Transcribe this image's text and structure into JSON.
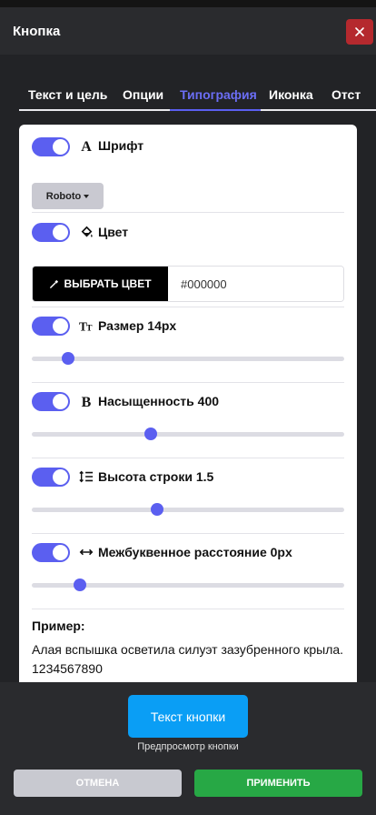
{
  "modal": {
    "title": "Кнопка",
    "close_icon": "close-icon"
  },
  "tabs": [
    {
      "label": "Текст и цель",
      "active": false
    },
    {
      "label": "Опции",
      "active": false
    },
    {
      "label": "Типография",
      "active": true
    },
    {
      "label": "Иконка",
      "active": false
    },
    {
      "label": "Отст",
      "active": false
    }
  ],
  "typography": {
    "font": {
      "enabled": true,
      "label": "Шрифт",
      "icon": "font-icon",
      "value": "Roboto"
    },
    "color": {
      "enabled": true,
      "label": "Цвет",
      "icon": "paint-bucket-icon",
      "pick_label": "ВЫБРАТЬ ЦВЕТ",
      "pick_icon": "eyedropper-icon",
      "value": "#000000"
    },
    "size": {
      "enabled": true,
      "label": "Размер 14px",
      "icon": "text-size-icon",
      "value": 14,
      "min": 0,
      "max": 100,
      "fraction": 0.115
    },
    "weight": {
      "enabled": true,
      "label": "Насыщенность 400",
      "icon": "font-weight-icon",
      "value": 400,
      "fraction": 0.38
    },
    "line_height": {
      "enabled": true,
      "label": "Высота строки 1.5",
      "icon": "line-height-icon",
      "value": 1.5,
      "fraction": 0.4
    },
    "letter_spacing": {
      "enabled": true,
      "label": "Межбуквенное расстояние 0px",
      "icon": "letter-spacing-icon",
      "value": 0,
      "fraction": 0.155
    }
  },
  "example": {
    "title": "Пример:",
    "text": "Алая вспышка осветила силуэт зазубренного крыла. 1234567890"
  },
  "footer": {
    "preview_button": "Текст кнопки",
    "preview_caption": "Предпросмотр кнопки",
    "cancel": "ОТМЕНА",
    "apply": "ПРИМЕНИТЬ"
  },
  "colors": {
    "accent": "#5b5ff0",
    "preview_button": "#0a9ef5",
    "apply": "#27a845",
    "cancel": "#c8c9d0",
    "close": "#b5292e"
  }
}
